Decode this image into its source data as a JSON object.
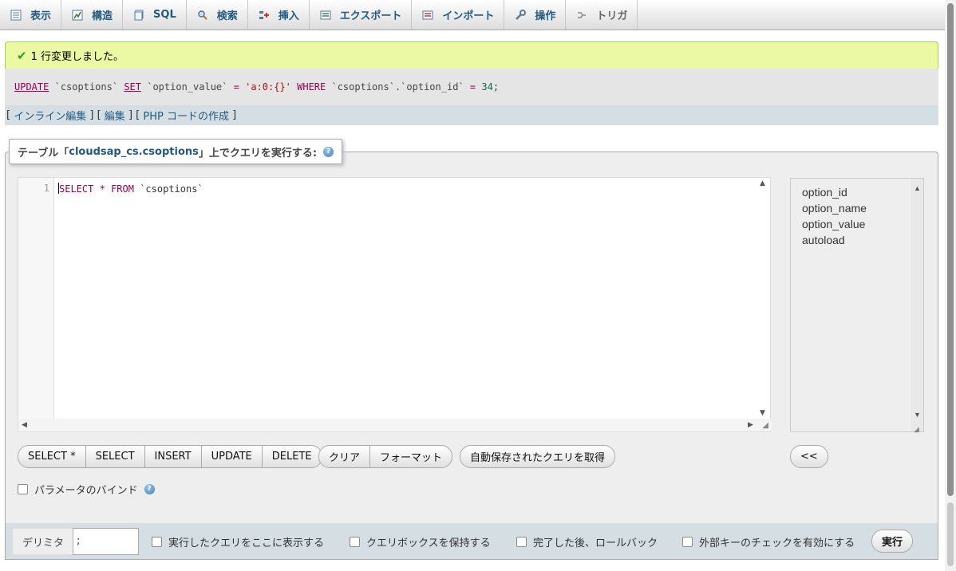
{
  "tabs": [
    {
      "label": "表示",
      "icon": "browse-icon"
    },
    {
      "label": "構造",
      "icon": "structure-icon"
    },
    {
      "label": "SQL",
      "icon": "sql-icon"
    },
    {
      "label": "検索",
      "icon": "search-icon"
    },
    {
      "label": "挿入",
      "icon": "insert-icon"
    },
    {
      "label": "エクスポート",
      "icon": "export-icon"
    },
    {
      "label": "インポート",
      "icon": "import-icon"
    },
    {
      "label": "操作",
      "icon": "wrench-icon"
    },
    {
      "label": "トリガ",
      "icon": "triggers-icon"
    }
  ],
  "message": {
    "success": "1 行変更しました。",
    "sql": {
      "kw_update": "UPDATE",
      "table": "`csoptions`",
      "kw_set": "SET",
      "column": "`option_value`",
      "eq1": "=",
      "value": "'a:0:{}'",
      "kw_where": "WHERE",
      "where_col": "`csoptions`.`option_id`",
      "eq2": "=",
      "where_val": "34",
      "semi": ";"
    },
    "links": {
      "inline_edit": "インライン編集",
      "edit": "編集",
      "create_php": "PHP コードの作成"
    }
  },
  "query_panel": {
    "legend_prefix": "テーブル「",
    "table_name": "cloudsap_cs.csoptions",
    "legend_suffix": "」上でクエリを実行する:",
    "line_number": "1",
    "code": {
      "select": "SELECT",
      "star": "*",
      "from": "FROM",
      "table": "`csoptions`"
    },
    "columns": [
      "option_id",
      "option_name",
      "option_value",
      "autoload"
    ],
    "buttons_sql": [
      "SELECT *",
      "SELECT",
      "INSERT",
      "UPDATE",
      "DELETE"
    ],
    "buttons_edit": [
      "クリア",
      "フォーマット"
    ],
    "button_autosave": "自動保存されたクエリを取得",
    "button_insert_col": "<<",
    "bind_params_label": "パラメータのバインド"
  },
  "bottom": {
    "delimiter_label": "デリミタ",
    "delimiter_value": ";",
    "options": [
      "実行したクエリをここに表示する",
      "クエリボックスを保持する",
      "完了した後、ロールバック",
      "外部キーのチェックを有効にする"
    ],
    "go_label": "実行"
  },
  "colors": {
    "accent": "#235a81",
    "success_bg": "#ebf8a4",
    "keyword": "#990055",
    "string": "#aa1111",
    "number": "#116644"
  }
}
